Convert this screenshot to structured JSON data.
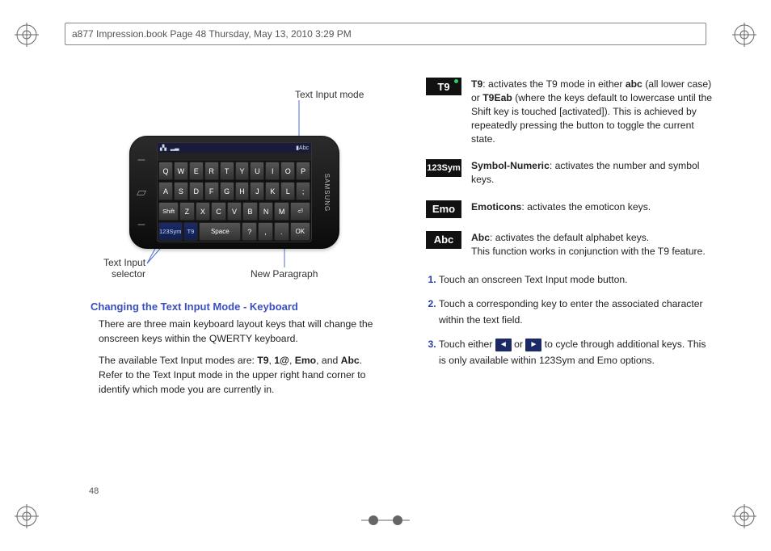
{
  "header": "a877 Impression.book  Page 48  Thursday, May 13, 2010  3:29 PM",
  "page_number": "48",
  "fig": {
    "ann_mode": "Text Input mode",
    "ann_selector_l1": "Text Input",
    "ann_selector_l2": "selector",
    "ann_newpara": "New Paragraph",
    "brand": "SAMSUNG",
    "status_left": "▞▖ ▂▃",
    "status_right": "▮Abc",
    "row1": [
      "Q",
      "W",
      "E",
      "R",
      "T",
      "Y",
      "U",
      "I",
      "O",
      "P"
    ],
    "row2": [
      "A",
      "S",
      "D",
      "F",
      "G",
      "H",
      "J",
      "K",
      "L",
      ";"
    ],
    "row3_first": "Shift",
    "row3": [
      "Z",
      "X",
      "C",
      "V",
      "B",
      "N",
      "M"
    ],
    "row3_last": "⏎",
    "row4": [
      "123Sym",
      "T9",
      "Space",
      "?",
      ",",
      ".",
      "OK"
    ]
  },
  "h1": "Changing the Text Input Mode - Keyboard",
  "p1": "There are three main keyboard layout keys that will change the onscreen keys within the QWERTY keyboard.",
  "p2_a": "The available Text Input modes are: ",
  "p2_b1": "T9",
  "p2_s1": ", ",
  "p2_b2": "1@",
  "p2_s2": ", ",
  "p2_b3": "Emo",
  "p2_s3": ", and ",
  "p2_b4": "Abc",
  "p2_c": ". Refer to the Text Input mode in the upper right hand corner to identify which mode you are currently in.",
  "modes": {
    "t9": {
      "icon": "T9",
      "b1": "T9",
      "t1": ": activates the T9 mode in either ",
      "b2": "abc",
      "t2": " (all lower case) or ",
      "b3": "T9Eab",
      "t3": " (where the keys default to lowercase until the Shift key is touched [activated]). This is achieved by repeatedly pressing the button to toggle the current state."
    },
    "sym": {
      "icon": "123Sym",
      "b1": "Symbol-Numeric",
      "t1": ": activates the number and symbol keys."
    },
    "emo": {
      "icon": "Emo",
      "b1": "Emoticons",
      "t1": ": activates the emoticon keys."
    },
    "abc": {
      "icon": "Abc",
      "b1": "Abc",
      "t1": ": activates the default alphabet keys.",
      "t2": "This function works in conjunction with the T9 feature."
    }
  },
  "steps": {
    "s1": "Touch an onscreen Text Input mode button.",
    "s2": "Touch a corresponding key to enter the associated character within the text field.",
    "s3a": "Touch either ",
    "s3or": " or ",
    "s3b": " to cycle through additional keys. This is only available within 123Sym and Emo options."
  },
  "glyph": {
    "left": "◄",
    "right": "►"
  }
}
